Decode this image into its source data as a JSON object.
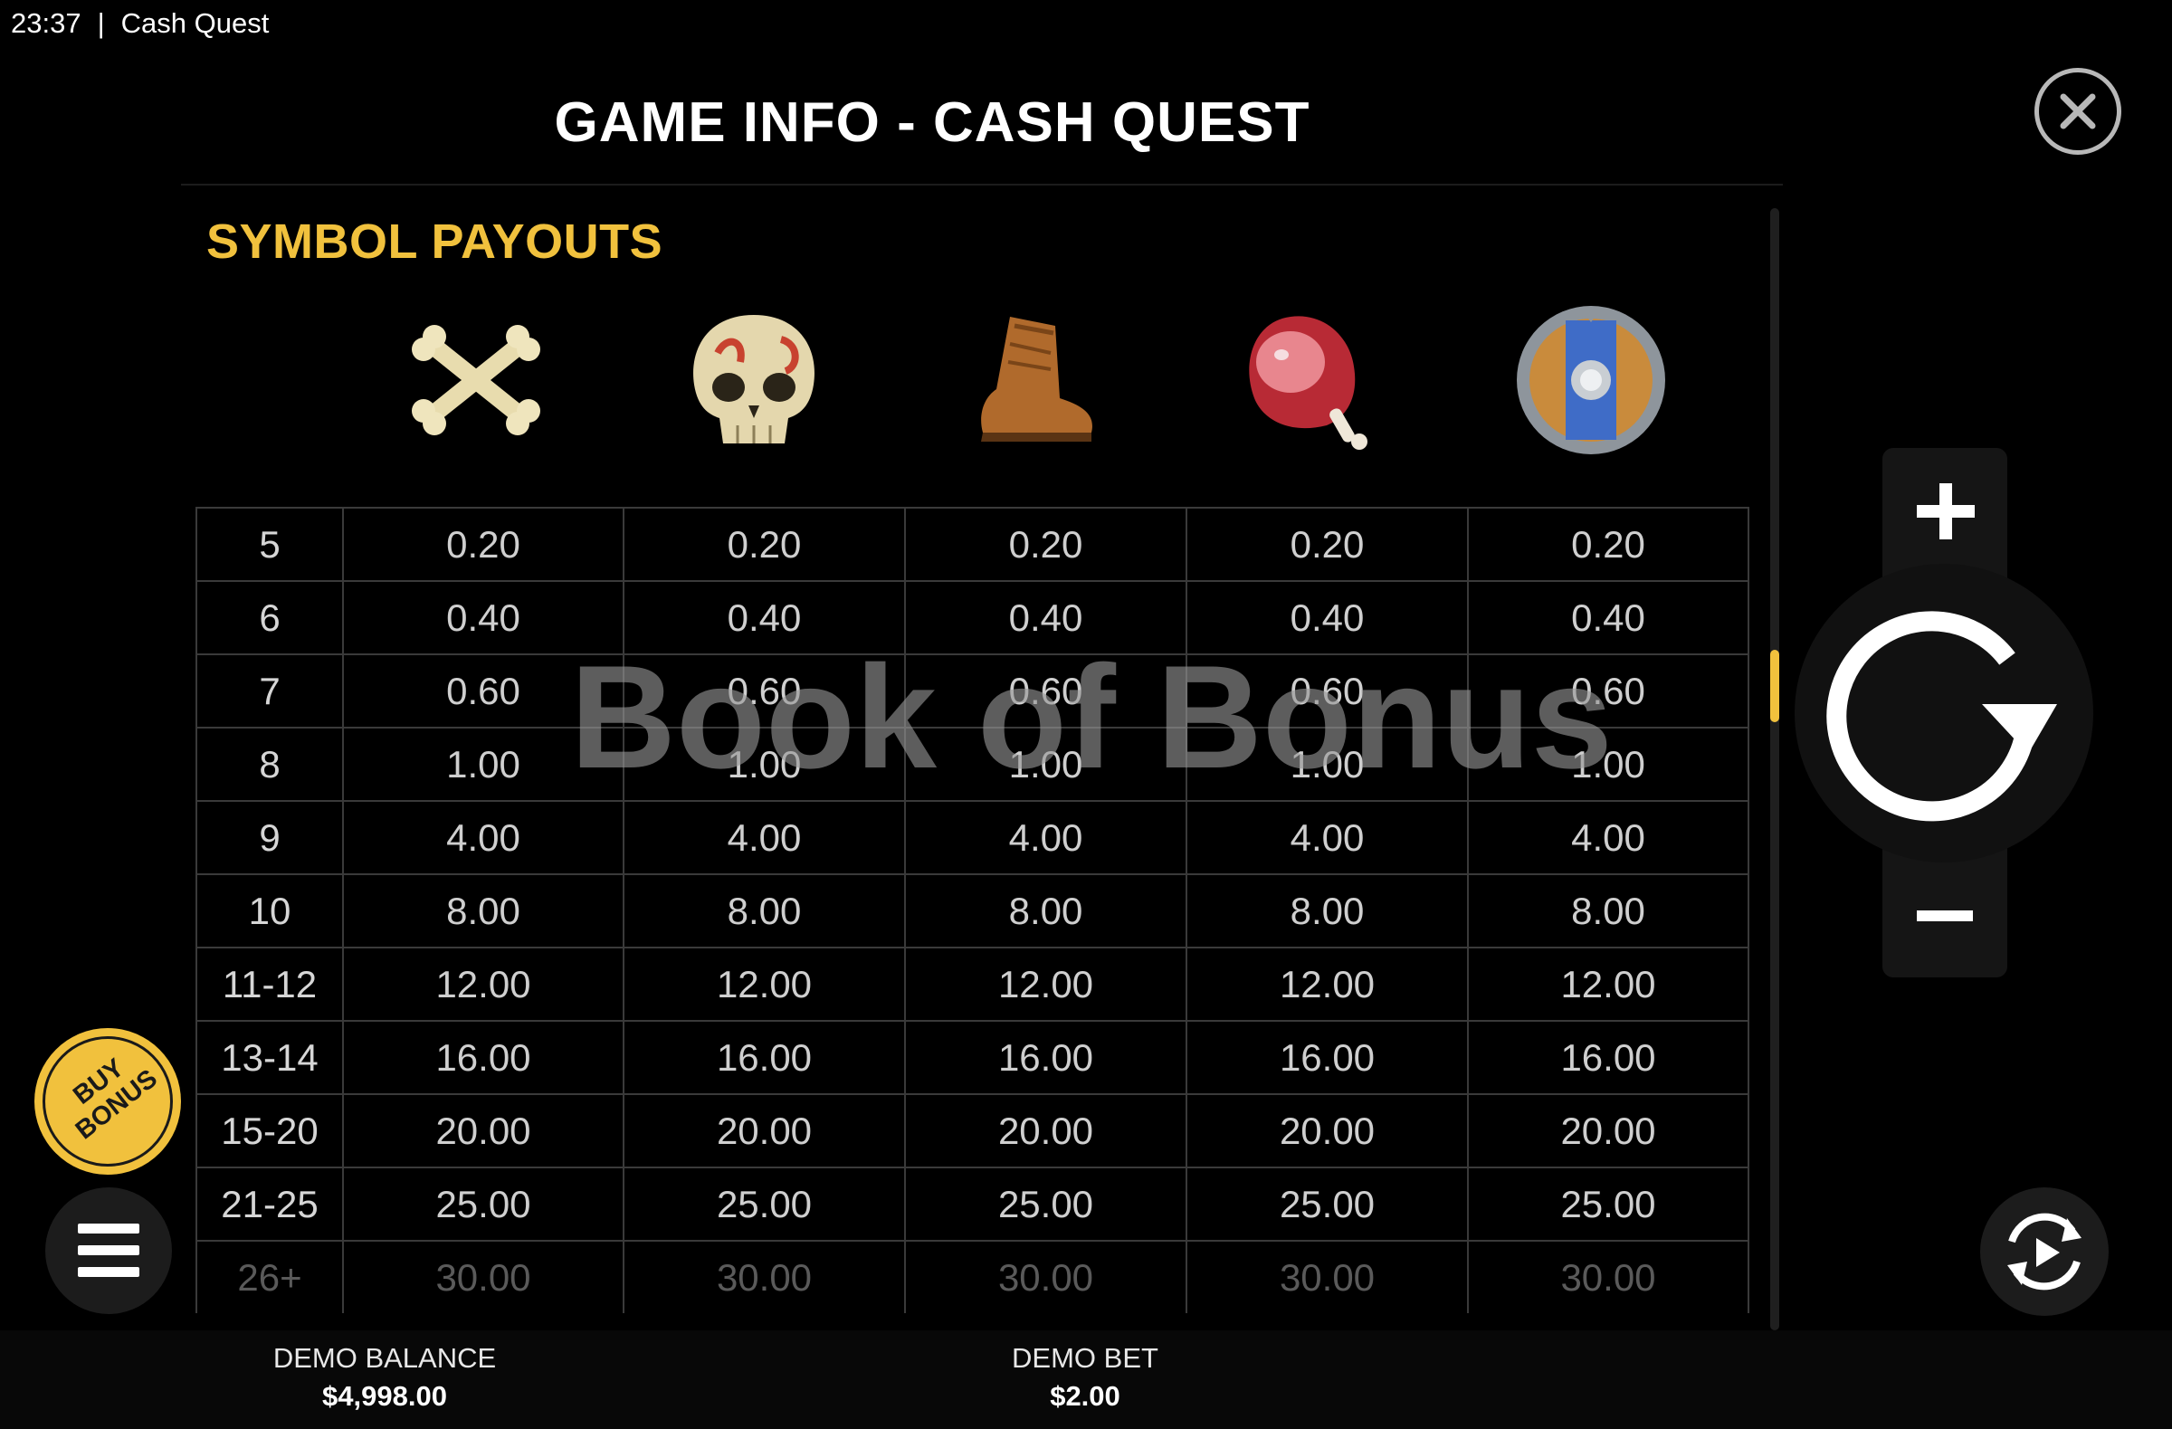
{
  "status_bar": {
    "time": "23:37",
    "separator": "|",
    "app_name": "Cash Quest"
  },
  "page_title": "GAME INFO - CASH QUEST",
  "section_title": "SYMBOL PAYOUTS",
  "symbols": [
    {
      "icon": "crossbones-icon"
    },
    {
      "icon": "skull-icon"
    },
    {
      "icon": "boot-icon"
    },
    {
      "icon": "ham-icon"
    },
    {
      "icon": "shield-icon"
    }
  ],
  "paytable": [
    {
      "count": "5",
      "payouts": [
        "0.20",
        "0.20",
        "0.20",
        "0.20",
        "0.20"
      ]
    },
    {
      "count": "6",
      "payouts": [
        "0.40",
        "0.40",
        "0.40",
        "0.40",
        "0.40"
      ]
    },
    {
      "count": "7",
      "payouts": [
        "0.60",
        "0.60",
        "0.60",
        "0.60",
        "0.60"
      ]
    },
    {
      "count": "8",
      "payouts": [
        "1.00",
        "1.00",
        "1.00",
        "1.00",
        "1.00"
      ]
    },
    {
      "count": "9",
      "payouts": [
        "4.00",
        "4.00",
        "4.00",
        "4.00",
        "4.00"
      ]
    },
    {
      "count": "10",
      "payouts": [
        "8.00",
        "8.00",
        "8.00",
        "8.00",
        "8.00"
      ]
    },
    {
      "count": "11-12",
      "payouts": [
        "12.00",
        "12.00",
        "12.00",
        "12.00",
        "12.00"
      ]
    },
    {
      "count": "13-14",
      "payouts": [
        "16.00",
        "16.00",
        "16.00",
        "16.00",
        "16.00"
      ]
    },
    {
      "count": "15-20",
      "payouts": [
        "20.00",
        "20.00",
        "20.00",
        "20.00",
        "20.00"
      ]
    },
    {
      "count": "21-25",
      "payouts": [
        "25.00",
        "25.00",
        "25.00",
        "25.00",
        "25.00"
      ]
    },
    {
      "count": "26+",
      "payouts": [
        "30.00",
        "30.00",
        "30.00",
        "30.00",
        "30.00"
      ]
    }
  ],
  "watermark": "Book of Bonus",
  "controls": {
    "buy_bonus_line1": "BUY",
    "buy_bonus_line2": "BONUS",
    "increase_bet_icon": "plus-icon",
    "decrease_bet_icon": "minus-icon",
    "spin_icon": "spin-arrow-icon",
    "menu_icon": "hamburger-menu-icon",
    "autoplay_icon": "autoplay-icon",
    "close_icon": "close-icon"
  },
  "footer": {
    "balance_label": "DEMO BALANCE",
    "balance_value": "$4,998.00",
    "bet_label": "DEMO BET",
    "bet_value": "$2.00"
  },
  "colors": {
    "accent": "#f1c13d",
    "background": "#000000",
    "grid": "#3a3a3a"
  }
}
